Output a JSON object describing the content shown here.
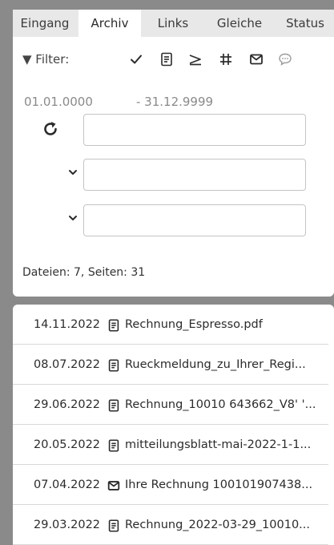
{
  "tabs": [
    {
      "label": "Eingang",
      "active": false
    },
    {
      "label": "Archiv",
      "active": true
    },
    {
      "label": "Links",
      "active": false
    },
    {
      "label": "Gleiche",
      "active": false
    },
    {
      "label": "Status",
      "active": false
    }
  ],
  "filter": {
    "label": "▼ Filter:",
    "icons": [
      "check-icon",
      "document-icon",
      "outgoing-icon",
      "grid-icon",
      "envelope-icon",
      "comment-icon"
    ],
    "date_from": "01.01.0000",
    "date_to": "- 31.12.9999",
    "field1_value": "",
    "field2_value": "",
    "field3_value": "",
    "count_text": "Dateien: 7, Seiten: 31"
  },
  "files": [
    {
      "date": "14.11.2022",
      "icon": "document-icon",
      "name": "Rechnung_Espresso.pdf"
    },
    {
      "date": "08.07.2022",
      "icon": "document-icon",
      "name": "Rueckmeldung_zu_Ihrer_Regi..."
    },
    {
      "date": "29.06.2022",
      "icon": "document-icon",
      "name": "Rechnung_10010 643662_V8' '..."
    },
    {
      "date": "20.05.2022",
      "icon": "document-icon",
      "name": "mitteilungsblatt-mai-2022-1-1..."
    },
    {
      "date": "07.04.2022",
      "icon": "envelope-icon",
      "name": "Ihre Rechnung 100101907438..."
    },
    {
      "date": "29.03.2022",
      "icon": "document-icon",
      "name": "Rechnung_2022-03-29_10010..."
    }
  ],
  "colors": {
    "background": "#8a8a8a",
    "tabbar": "#e8e8e8",
    "panel": "#ffffff",
    "muted": "#8a8a8a"
  }
}
